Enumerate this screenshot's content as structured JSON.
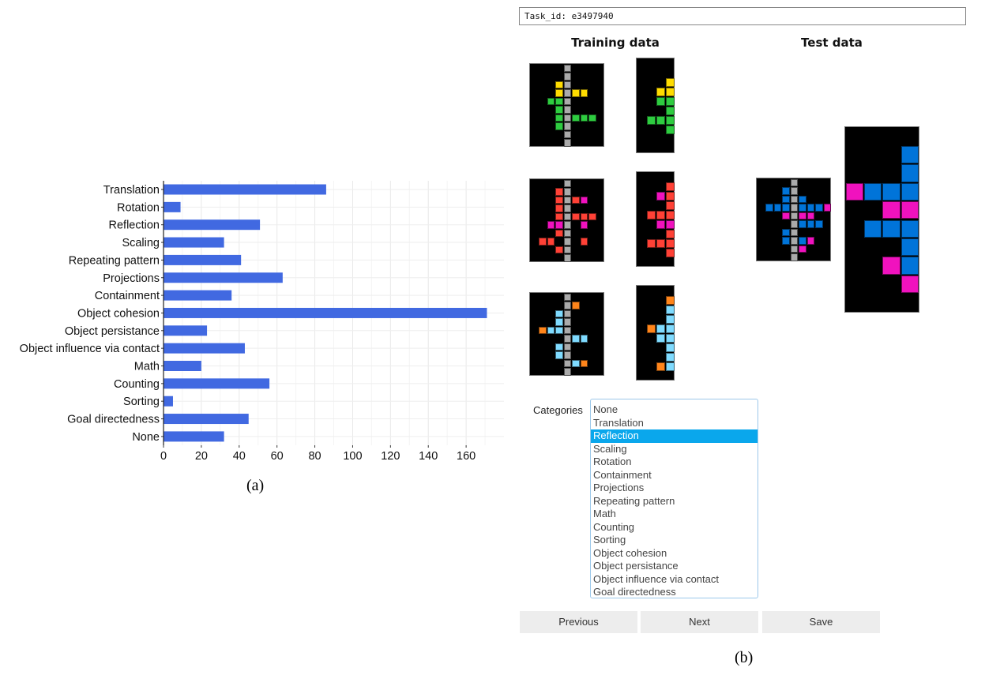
{
  "chart_data": {
    "type": "bar",
    "orientation": "horizontal",
    "categories": [
      "Translation",
      "Rotation",
      "Reflection",
      "Scaling",
      "Repeating pattern",
      "Projections",
      "Containment",
      "Object cohesion",
      "Object persistance",
      "Object influence via contact",
      "Math",
      "Counting",
      "Sorting",
      "Goal directedness",
      "None"
    ],
    "values": [
      86,
      9,
      51,
      32,
      41,
      63,
      36,
      171,
      23,
      43,
      20,
      56,
      5,
      45,
      32
    ],
    "xticks": [
      0,
      20,
      40,
      60,
      80,
      100,
      120,
      140,
      160
    ],
    "xlim": [
      0,
      180
    ],
    "grid": true,
    "bar_color": "#4169e1",
    "title": "",
    "xlabel": "",
    "ylabel": ""
  },
  "captions": {
    "a": "(a)",
    "b": "(b)"
  },
  "ui": {
    "task_id": "Task_id: e3497940",
    "training_title": "Training data",
    "test_title": "Test data",
    "palette": {
      "0": "#000000",
      "1": "#0074D9",
      "2": "#FF4136",
      "3": "#2ECC40",
      "4": "#FFDC00",
      "5": "#AAAAAA",
      "6": "#F012BE",
      "7": "#FF851B",
      "8": "#7FDBFF"
    },
    "training_pairs": [
      {
        "input": [
          "000050000",
          "000050000",
          "000450000",
          "000454400",
          "003350000",
          "000350000",
          "000353330",
          "000350000",
          "000050000",
          "000050000"
        ],
        "output": [
          "0000",
          "0000",
          "0004",
          "0044",
          "0033",
          "0003",
          "0333",
          "0003",
          "0000",
          "0000"
        ]
      },
      {
        "input": [
          "000050000",
          "000250000",
          "000252600",
          "000250000",
          "000252220",
          "006650600",
          "000250000",
          "022050200",
          "000250000",
          "000050000"
        ],
        "output": [
          "0000",
          "0002",
          "0062",
          "0002",
          "0222",
          "0066",
          "0002",
          "0222",
          "0002",
          "0000"
        ]
      },
      {
        "input": [
          "000050000",
          "000057000",
          "000850000",
          "000850000",
          "078850000",
          "000058800",
          "000850000",
          "000850000",
          "000058700",
          "000050000"
        ],
        "output": [
          "0000",
          "0007",
          "0008",
          "0008",
          "0788",
          "0088",
          "0008",
          "0008",
          "0078",
          "0000"
        ]
      }
    ],
    "test": {
      "input": [
        "000050000",
        "000150000",
        "000151000",
        "011151116",
        "000656600",
        "000051110",
        "000150000",
        "000151600",
        "000056000",
        "000050000"
      ],
      "output": [
        "0000",
        "0001",
        "0001",
        "6111",
        "0066",
        "0111",
        "0001",
        "0061",
        "0006",
        "0000"
      ]
    },
    "categories_label": "Categories",
    "categories": [
      "None",
      "Translation",
      "Reflection",
      "Scaling",
      "Rotation",
      "Containment",
      "Projections",
      "Repeating pattern",
      "Math",
      "Counting",
      "Sorting",
      "Object cohesion",
      "Object persistance",
      "Object influence via contact",
      "Goal directedness"
    ],
    "selected_category": "Reflection",
    "buttons": {
      "previous": "Previous",
      "next": "Next",
      "save": "Save"
    }
  }
}
